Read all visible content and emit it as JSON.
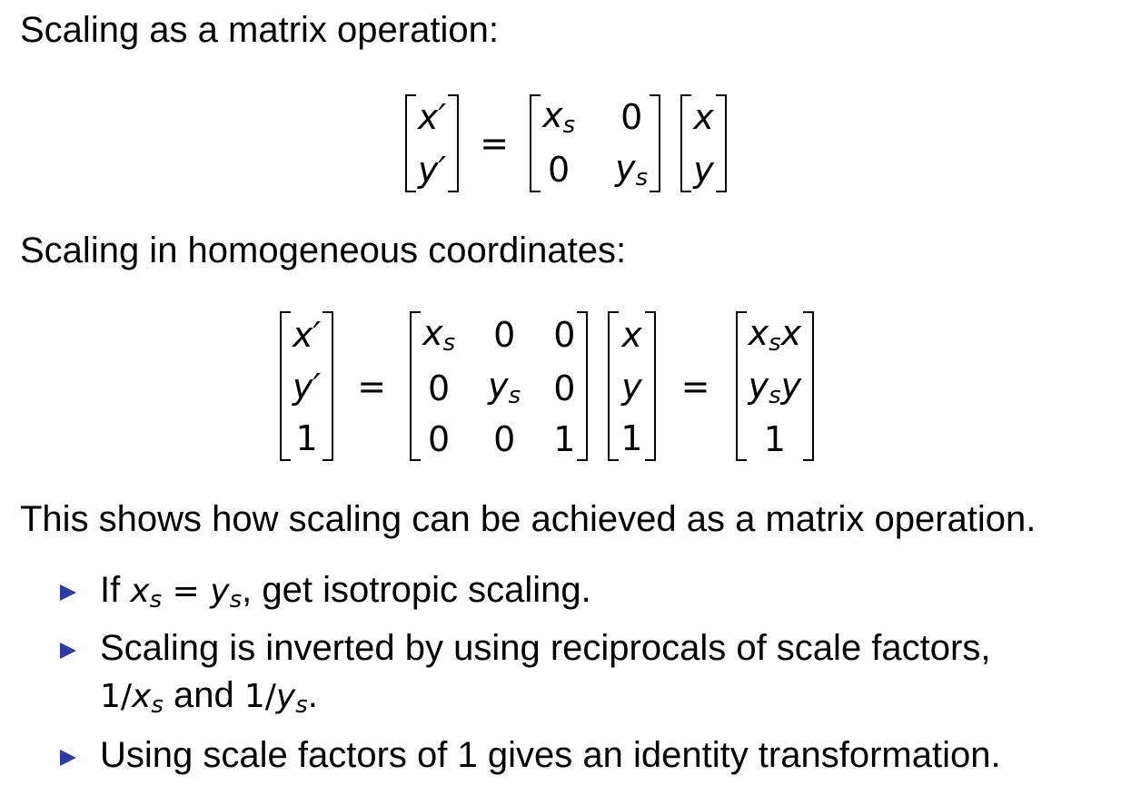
{
  "heading_matrix": "Scaling as a matrix operation:",
  "heading_homogeneous": "Scaling in homogeneous coordinates:",
  "eq1": {
    "lhs": [
      "x′",
      "y′"
    ],
    "equals": "=",
    "matrix": [
      [
        "x_s",
        "0"
      ],
      [
        "0",
        "y_s"
      ]
    ],
    "vector": [
      "x",
      "y"
    ]
  },
  "eq2": {
    "lhs": [
      "x′",
      "y′",
      "1"
    ],
    "equals": "=",
    "matrix": [
      [
        "x_s",
        "0",
        "0"
      ],
      [
        "0",
        "y_s",
        "0"
      ],
      [
        "0",
        "0",
        "1"
      ]
    ],
    "vector": [
      "x",
      "y",
      "1"
    ],
    "result": [
      "x_s x",
      "y_s y",
      "1"
    ]
  },
  "summary": "This shows how scaling can be achieved as a matrix operation.",
  "bullets": [
    {
      "pre": "If ",
      "math": "x_s = y_s",
      "post": ", get isotropic scaling."
    },
    {
      "line1": "Scaling is inverted by using reciprocals of scale factors,",
      "line2_math_a": "1/x_s",
      "line2_mid": " and ",
      "line2_math_b": "1/y_s",
      "line2_end": "."
    },
    {
      "text": "Using scale factors of 1 gives an identity transformation."
    }
  ],
  "colors": {
    "bullet_marker": "#2b3aa8",
    "text": "#000000"
  }
}
